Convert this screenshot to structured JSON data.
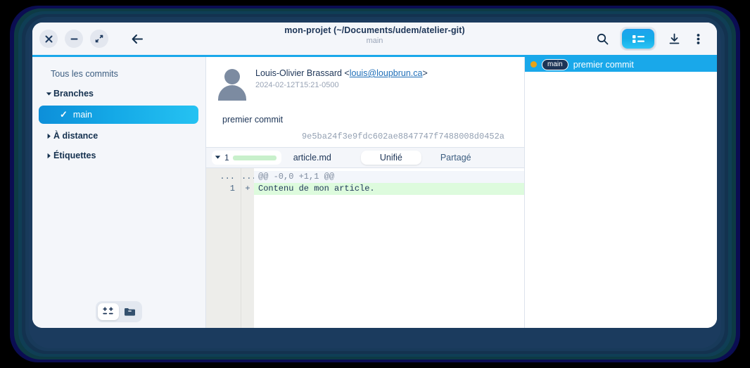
{
  "window": {
    "title": "mon-projet (~/Documents/udem/atelier-git)",
    "subtitle": "main",
    "controls": {
      "close": "×",
      "minimize": "−",
      "maximize": "⤢",
      "back": "←"
    }
  },
  "toolbar": {
    "search_icon": "search-icon",
    "list_view_icon": "list-view-icon",
    "download_icon": "download-icon",
    "menu_icon": "kebab-menu-icon",
    "accent_color": "#19a8ea"
  },
  "sidebar": {
    "all_commits": "Tous les commits",
    "groups": [
      {
        "label": "Branches",
        "expanded": true
      },
      {
        "label": "À distance",
        "expanded": false
      },
      {
        "label": "Étiquettes",
        "expanded": false
      }
    ],
    "selected_branch": {
      "label": "main",
      "check": "✓"
    },
    "footer": {
      "diff_stat_icon": "diff-stat-icon",
      "archive_icon": "archive-folder-icon"
    }
  },
  "commit": {
    "author_prefix": "Louis-Olivier Brassard <",
    "author_email": "louis@loupbrun.ca",
    "author_suffix": ">",
    "date": "2024-02-12T15:21-0500",
    "message": "premier commit",
    "hash": "9e5ba24f3e9fdc602ae8847747f7488008d0452a"
  },
  "diff": {
    "stat_count": "1",
    "file_name": "article.md",
    "tabs": [
      {
        "label": "Unifié",
        "active": true
      },
      {
        "label": "Partagé",
        "active": false
      }
    ],
    "gutter_old": "...",
    "gutter_new": "...",
    "hunk_header": "@@ -0,0 +1,1 @@",
    "added_line_number": "1",
    "added_line_sign": "+",
    "added_line_text": "Contenu de mon article.",
    "added_bg_color": "#ddfbdd"
  },
  "commit_list": {
    "rows": [
      {
        "badge": "main",
        "subject": "premier commit",
        "dot_color": "#e8a317",
        "selected": true
      }
    ]
  }
}
